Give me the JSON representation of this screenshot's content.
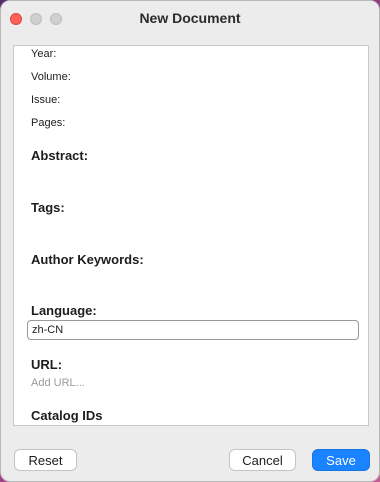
{
  "window": {
    "title": "New Document"
  },
  "fields": {
    "year_label": "Year:",
    "volume_label": "Volume:",
    "issue_label": "Issue:",
    "pages_label": "Pages:",
    "abstract_label": "Abstract:",
    "tags_label": "Tags:",
    "author_keywords_label": "Author Keywords:",
    "language_label": "Language:",
    "language_value": "zh-CN",
    "url_label": "URL:",
    "url_placeholder": "Add URL...",
    "catalog_ids_label": "Catalog IDs"
  },
  "buttons": {
    "reset": "Reset",
    "cancel": "Cancel",
    "save": "Save"
  },
  "colors": {
    "accent": "#1a83ff",
    "close": "#fe5f57"
  }
}
